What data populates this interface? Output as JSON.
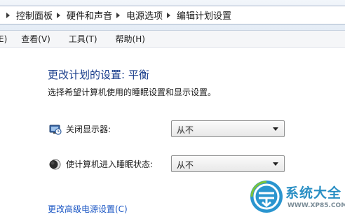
{
  "breadcrumb": {
    "items": [
      "控制面板",
      "硬件和声音",
      "电源选项",
      "编辑计划设置"
    ]
  },
  "menu": {
    "clipped_item": "E)",
    "items": [
      "查看(V)",
      "工具(T)",
      "帮助(H)"
    ]
  },
  "main": {
    "title": "更改计划的设置: 平衡",
    "subtitle": "选择希望计算机使用的睡眠设置和显示设置。",
    "settings": [
      {
        "label": "关闭显示器:",
        "value": "从不",
        "icon": "monitor-clock-icon"
      },
      {
        "label": "使计算机进入睡眠状态:",
        "value": "从不",
        "icon": "moon-icon"
      }
    ],
    "advanced_link": "更改高级电源设置(C)"
  },
  "watermark": {
    "text": "系统大全",
    "url": "WWW.XP85.COM"
  },
  "colors": {
    "title": "#1a3e8c",
    "link": "#1a56c4",
    "watermark": "#2a8fc4"
  }
}
